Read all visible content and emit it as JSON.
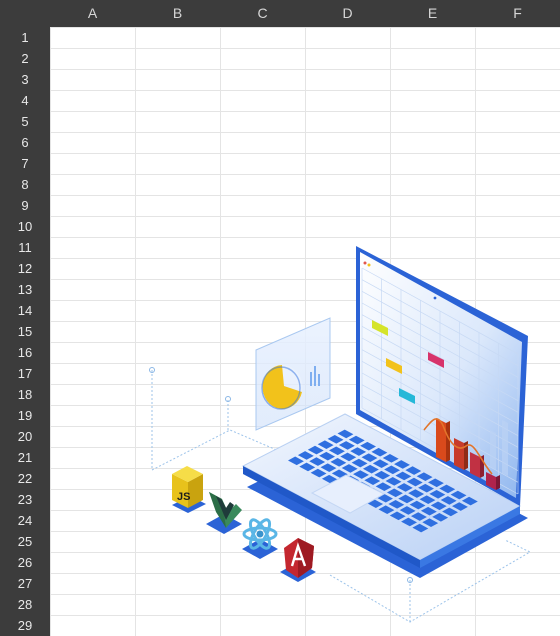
{
  "columns": [
    "A",
    "B",
    "C",
    "D",
    "E",
    "F"
  ],
  "rows": [
    "1",
    "2",
    "3",
    "4",
    "5",
    "6",
    "7",
    "8",
    "9",
    "10",
    "11",
    "12",
    "13",
    "14",
    "15",
    "16",
    "17",
    "18",
    "19",
    "20",
    "21",
    "22",
    "23",
    "24",
    "25",
    "26",
    "27",
    "28",
    "29"
  ],
  "illustration": {
    "subject": "isometric-laptop-with-spreadsheet-and-charts",
    "badges": [
      {
        "icon": "javascript-logo-icon",
        "text": "JS",
        "color": "#f4d92a"
      },
      {
        "icon": "vue-logo-icon",
        "color": "#3a8a5c"
      },
      {
        "icon": "react-logo-icon",
        "color": "#5ab6e6"
      },
      {
        "icon": "angular-logo-icon",
        "color": "#c4272f"
      }
    ],
    "colors": {
      "laptop": "#2f6fe0",
      "chart-bars": "#d94a1c",
      "pie": "#f2c21b"
    }
  }
}
